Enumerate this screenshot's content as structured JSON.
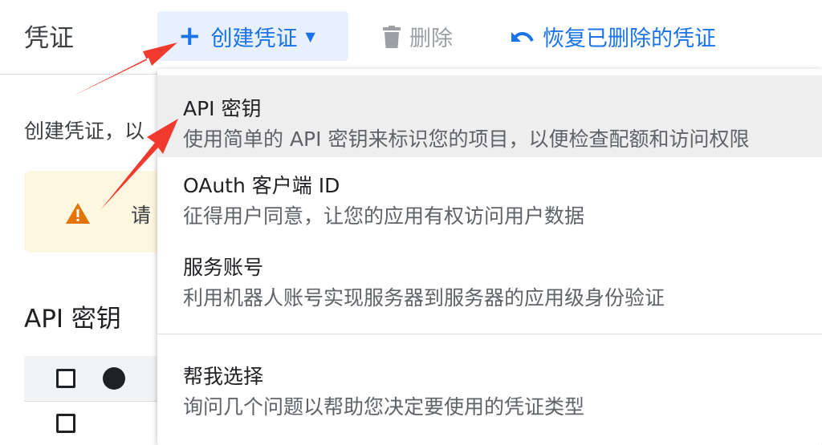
{
  "header": {
    "title": "凭证",
    "create_label": "创建凭证",
    "delete_label": "删除",
    "restore_label": "恢复已删除的凭证"
  },
  "main": {
    "intro_text": "创建凭证，以",
    "warning_text": "请",
    "section_title": "API 密钥"
  },
  "menu": {
    "items": [
      {
        "title": "API 密钥",
        "desc": "使用简单的 API 密钥来标识您的项目，以便检查配额和访问权限"
      },
      {
        "title": "OAuth 客户端 ID",
        "desc": "征得用户同意，让您的应用有权访问用户数据"
      },
      {
        "title": "服务账号",
        "desc": "利用机器人账号实现服务器到服务器的应用级身份验证"
      },
      {
        "title": "帮我选择",
        "desc": "询问几个问题以帮助您决定要使用的凭证类型"
      }
    ]
  },
  "colors": {
    "accent": "#1a73e8",
    "annotation_arrow": "#f03a2e",
    "warning_bg": "#fef7e0",
    "warning_icon": "#e37400"
  },
  "icons": {
    "create": "plus-icon",
    "dropdown": "caret-down-icon",
    "delete": "trash-icon",
    "restore": "undo-icon",
    "warning": "warning-icon"
  }
}
